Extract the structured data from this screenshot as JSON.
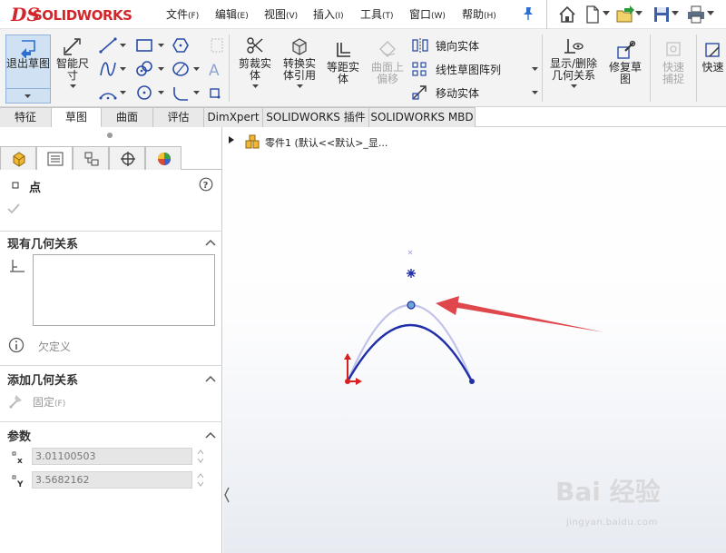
{
  "app": {
    "logo_text": "SOLIDWORKS",
    "logo_mark": "DS"
  },
  "menu": [
    {
      "label": "文件",
      "key": "(F)"
    },
    {
      "label": "编辑",
      "key": "(E)"
    },
    {
      "label": "视图",
      "key": "(V)"
    },
    {
      "label": "插入",
      "key": "(I)"
    },
    {
      "label": "工具",
      "key": "(T)"
    },
    {
      "label": "窗口",
      "key": "(W)"
    },
    {
      "label": "帮助",
      "key": "(H)"
    }
  ],
  "ribbon": {
    "exit_sketch": "退出草图",
    "smart_dimension": "智能尺寸",
    "trim": "剪裁实体",
    "convert": "转换实体引用",
    "offset": "等距实体",
    "surface_offset": "曲面上偏移",
    "mirror": "镜向实体",
    "linear_pattern": "线性草图阵列",
    "move": "移动实体",
    "show_delete_relations": "显示/删除几何关系",
    "repair_sketch": "修复草图",
    "quick_snaps": "快速捕捉",
    "quick_view": "快速"
  },
  "tabs": [
    "特征",
    "草图",
    "曲面",
    "评估",
    "DimXpert",
    "SOLIDWORKS 插件",
    "SOLIDWORKS MBD"
  ],
  "active_tab": 1,
  "tree": {
    "part_label": "零件1  (默认<<默认>_显..."
  },
  "property": {
    "title": "点",
    "existing_relations": "现有几何关系",
    "status": "欠定义",
    "add_relations": "添加几何关系",
    "fix": "固定",
    "fix_key": "(F)",
    "parameters": "参数",
    "x_value": "3.01100503",
    "y_value": "3.5682162"
  },
  "watermark": {
    "logo": "Bai 经验",
    "url": "jingyan.baidu.com"
  },
  "colors": {
    "accent": "#d1262b",
    "curve": "#1f2fa8",
    "construction": "#b8b9e8",
    "arrow": "#e0474c",
    "active_bg": "#cfe1f2"
  }
}
